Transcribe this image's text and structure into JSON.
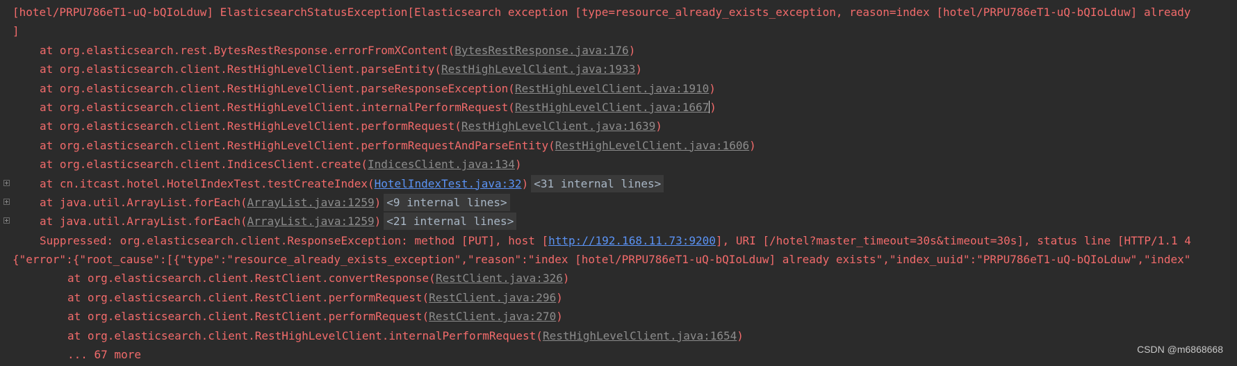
{
  "console": {
    "header_line_1": "[hotel/PRPU786eT1-uQ-bQIoLduw] ElasticsearchStatusException[Elasticsearch exception [type=resource_already_exists_exception, reason=index [hotel/PRPU786eT1-uQ-bQIoLduw] already",
    "header_line_2": "]",
    "frames": [
      {
        "prefix": "at org.elasticsearch.rest.BytesRestResponse.errorFromXContent(",
        "link": "BytesRestResponse.java:176",
        "suffix": ")"
      },
      {
        "prefix": "at org.elasticsearch.client.RestHighLevelClient.parseEntity(",
        "link": "RestHighLevelClient.java:1933",
        "suffix": ")"
      },
      {
        "prefix": "at org.elasticsearch.client.RestHighLevelClient.parseResponseException(",
        "link": "RestHighLevelClient.java:1910",
        "suffix": ")"
      },
      {
        "prefix": "at org.elasticsearch.client.RestHighLevelClient.internalPerformRequest(",
        "link": "RestHighLevelClient.java:1667",
        "suffix": ")"
      },
      {
        "prefix": "at org.elasticsearch.client.RestHighLevelClient.performRequest(",
        "link": "RestHighLevelClient.java:1639",
        "suffix": ")"
      },
      {
        "prefix": "at org.elasticsearch.client.RestHighLevelClient.performRequestAndParseEntity(",
        "link": "RestHighLevelClient.java:1606",
        "suffix": ")"
      },
      {
        "prefix": "at org.elasticsearch.client.IndicesClient.create(",
        "link": "IndicesClient.java:134",
        "suffix": ")"
      },
      {
        "prefix": "at cn.itcast.hotel.HotelIndexTest.testCreateIndex(",
        "link": "HotelIndexTest.java:32",
        "suffix": ")",
        "folded": "<31 internal lines>"
      },
      {
        "prefix": "at java.util.ArrayList.forEach(",
        "link": "ArrayList.java:1259",
        "suffix": ")",
        "folded": "<9 internal lines>"
      },
      {
        "prefix": "at java.util.ArrayList.forEach(",
        "link": "ArrayList.java:1259",
        "suffix": ")",
        "folded": "<21 internal lines>"
      }
    ],
    "suppressed": {
      "prefix": "Suppressed: org.elasticsearch.client.ResponseException: method [PUT], host [",
      "link": "http://192.168.11.73:9200",
      "suffix": "], URI [/hotel?master_timeout=30s&timeout=30s], status line [HTTP/1.1 4"
    },
    "json_line": "{\"error\":{\"root_cause\":[{\"type\":\"resource_already_exists_exception\",\"reason\":\"index [hotel/PRPU786eT1-uQ-bQIoLduw] already exists\",\"index_uuid\":\"PRPU786eT1-uQ-bQIoLduw\",\"index\"",
    "nested_frames": [
      {
        "prefix": "at org.elasticsearch.client.RestClient.convertResponse(",
        "link": "RestClient.java:326",
        "suffix": ")"
      },
      {
        "prefix": "at org.elasticsearch.client.RestClient.performRequest(",
        "link": "RestClient.java:296",
        "suffix": ")"
      },
      {
        "prefix": "at org.elasticsearch.client.RestClient.performRequest(",
        "link": "RestClient.java:270",
        "suffix": ")"
      },
      {
        "prefix": "at org.elasticsearch.client.RestHighLevelClient.internalPerformRequest(",
        "link": "RestHighLevelClient.java:1654",
        "suffix": ")"
      }
    ],
    "more": "... 67 more"
  },
  "watermark": "CSDN @m6868668",
  "colors": {
    "background": "#2b2b2b",
    "error_text": "#f26b6b",
    "link_gray": "#8c8c8c",
    "link_blue": "#5b93f5",
    "folded_bg": "#3a3a3a"
  },
  "icons": {
    "expand": "expand-plus-icon"
  }
}
